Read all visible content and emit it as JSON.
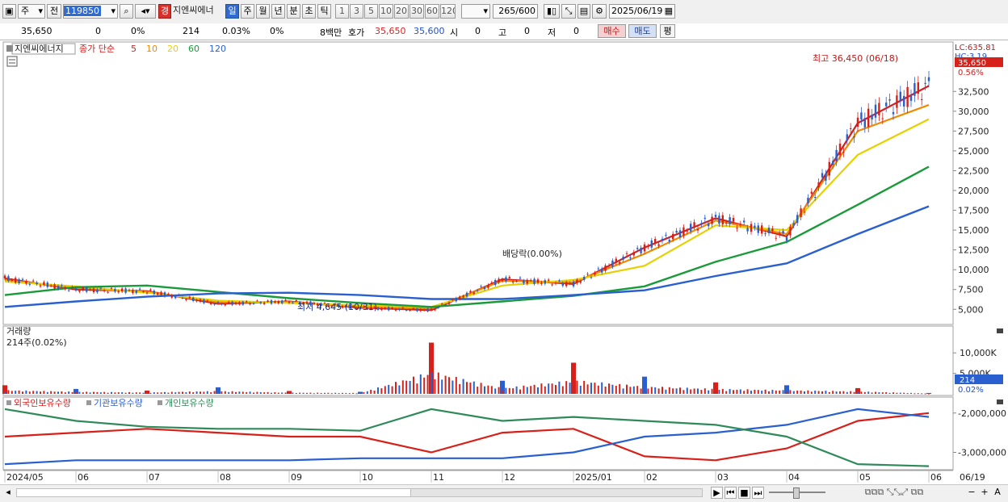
{
  "toolbar": {
    "type_label": "주",
    "prev_label": "전",
    "code_value": "119850",
    "stock_name_badge": "경",
    "stock_name": "지엔씨에너",
    "period_tabs": [
      "일",
      "주",
      "월",
      "년",
      "분",
      "초",
      "틱"
    ],
    "active_period": "일",
    "interval_buttons": [
      "1",
      "3",
      "5",
      "10",
      "20",
      "30",
      "60",
      "120"
    ],
    "count_value": "265",
    "count_total": "/600",
    "date_value": "2025/06/19"
  },
  "info_bar": {
    "price": "35,650",
    "change": "0",
    "change_pct": "0%",
    "volume": "214",
    "vol_pct": "0.03%",
    "pct2": "0%",
    "amount": "8백만",
    "quote_label": "호가",
    "ask": "35,650",
    "bid": "35,600",
    "open_label": "시",
    "open": "0",
    "high_label": "고",
    "high": "0",
    "low_label": "저",
    "low": "0",
    "buy_label": "매수",
    "sell_label": "매도",
    "avg_label": "평"
  },
  "price_panel": {
    "title": "지엔씨에너지",
    "ma_label": "종가 단순",
    "ma_periods": [
      {
        "label": "5",
        "color": "#d22020"
      },
      {
        "label": "10",
        "color": "#f08a00"
      },
      {
        "label": "20",
        "color": "#e6d000"
      },
      {
        "label": "60",
        "color": "#1a9a3a"
      },
      {
        "label": "120",
        "color": "#2a5fd0"
      }
    ],
    "y_ticks": [
      "32,500",
      "30,000",
      "27,500",
      "25,000",
      "22,500",
      "20,000",
      "17,500",
      "15,000",
      "12,500",
      "10,000",
      "7,500",
      "5,000"
    ],
    "lc_label": "LC:635.81",
    "hc_label": "HC:3.19",
    "current_price_tag": "35,650",
    "pct_label": "0.56%",
    "high_annotation": "최고 36,450 (06/18)",
    "low_annotation": "최저 4,645 (10/31)",
    "dividend_annotation": "배당락(0.00%)"
  },
  "volume_panel": {
    "title": "거래량",
    "sub_label": "214주(0.02%)",
    "y_ticks": [
      "10,000K",
      "5,000K"
    ],
    "current_tag": "214",
    "pct_label": "0.02%"
  },
  "holding_panel": {
    "legend": [
      {
        "label": "외국인보유수량",
        "color": "#d22020"
      },
      {
        "label": "기관보유수량",
        "color": "#2a5fd0"
      },
      {
        "label": "개인보유수량",
        "color": "#2f8a5a"
      }
    ],
    "y_ticks": [
      "-2,000,000",
      "-3,000,000"
    ]
  },
  "x_axis": {
    "labels": [
      "2024/05",
      "06",
      "07",
      "08",
      "09",
      "10",
      "11",
      "12",
      "2025/01",
      "02",
      "03",
      "04",
      "05",
      "06"
    ],
    "right_label": "06/19"
  },
  "chart_data": {
    "type": "candlestick",
    "title": "지엔씨에너지",
    "xlabel": "",
    "ylabel": "",
    "x": [
      "2024/05",
      "06",
      "07",
      "08",
      "09",
      "10",
      "11",
      "12",
      "2025/01",
      "02",
      "03",
      "04",
      "05",
      "06"
    ],
    "ylim": [
      3500,
      36500
    ],
    "series": [
      {
        "name": "5",
        "values": [
          8900,
          7500,
          7300,
          5700,
          6000,
          5200,
          4900,
          8800,
          8200,
          12800,
          16500,
          14200,
          28500,
          33200
        ]
      },
      {
        "name": "10",
        "values": [
          8700,
          7700,
          7200,
          5900,
          5900,
          5300,
          5100,
          8600,
          8400,
          12000,
          16200,
          14500,
          27500,
          30800
        ]
      },
      {
        "name": "20",
        "values": [
          8500,
          7900,
          7100,
          6100,
          5800,
          5500,
          5300,
          8000,
          8700,
          10500,
          15600,
          15000,
          24500,
          29000
        ]
      },
      {
        "name": "60",
        "values": [
          6800,
          7800,
          8000,
          7200,
          6400,
          5800,
          5300,
          6000,
          6700,
          7900,
          11000,
          13500,
          18200,
          23000
        ]
      },
      {
        "name": "120",
        "values": [
          5300,
          6000,
          6600,
          7000,
          7100,
          6800,
          6300,
          6300,
          6800,
          7400,
          9200,
          10800,
          14500,
          18000
        ]
      }
    ],
    "volume": [
      2100,
      1200,
      800,
      1600,
      700,
      500,
      12500,
      3200,
      7600,
      4200,
      2800,
      2100,
      1400,
      214
    ],
    "holdings": {
      "foreign": [
        -2600000,
        -2500000,
        -2400000,
        -2500000,
        -2600000,
        -2600000,
        -3000000,
        -2500000,
        -2400000,
        -3100000,
        -3200000,
        -2900000,
        -2200000,
        -2000000
      ],
      "institution": [
        -3300000,
        -3200000,
        -3200000,
        -3200000,
        -3200000,
        -3150000,
        -3150000,
        -3150000,
        -3000000,
        -2600000,
        -2500000,
        -2300000,
        -1900000,
        -2100000
      ],
      "individual": [
        -1900000,
        -2200000,
        -2350000,
        -2400000,
        -2400000,
        -2450000,
        -1900000,
        -2200000,
        -2100000,
        -2200000,
        -2300000,
        -2600000,
        -3300000,
        -3350000
      ]
    }
  },
  "bottom_bar": {
    "nav_buttons": [
      "▶",
      "⏮",
      "■",
      "⏭"
    ],
    "tools": [
      "−",
      "+",
      "A"
    ]
  }
}
